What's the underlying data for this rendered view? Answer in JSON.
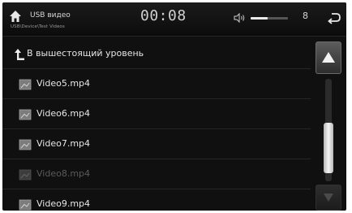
{
  "header": {
    "source_title": "USB видео",
    "path": "USB\\Device\\Test Videos",
    "clock": "00:08",
    "volume": {
      "level": 8,
      "fraction": 0.45
    },
    "icons": {
      "home": "home-icon",
      "volume": "speaker-icon",
      "back": "back-arrow-icon"
    }
  },
  "list": {
    "up_label": "В вышестоящий уровень",
    "items": [
      {
        "label": "Video5.mp4",
        "state": "normal"
      },
      {
        "label": "Video6.mp4",
        "state": "normal"
      },
      {
        "label": "Video7.mp4",
        "state": "normal"
      },
      {
        "label": "Video8.mp4",
        "state": "dimmed"
      },
      {
        "label": "Video9.mp4",
        "state": "normal"
      }
    ]
  },
  "scrollbar": {
    "position": 0.85
  },
  "colors": {
    "background": "#101010",
    "text": "#e6e6e6",
    "dim_text": "#5a5a5a"
  }
}
